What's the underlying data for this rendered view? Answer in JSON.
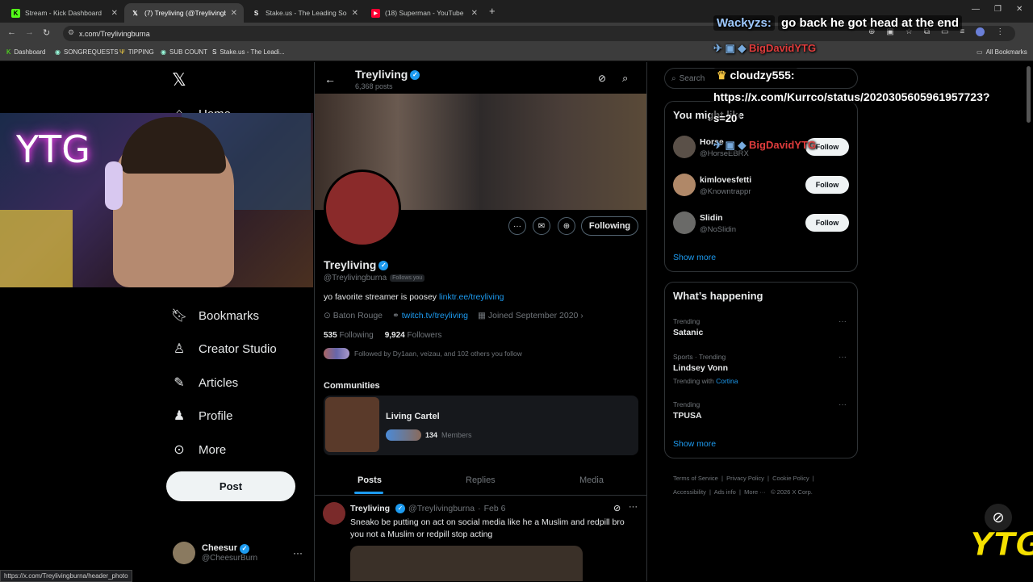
{
  "browser": {
    "tabs": [
      {
        "title": "Stream - Kick Dashboard",
        "favicon": "kick-icon"
      },
      {
        "title": "(7) Treyliving (@Treylivingburna) / X",
        "favicon": "x-icon"
      },
      {
        "title": "Stake.us - The Leading Social Casino",
        "favicon": "stake-icon"
      },
      {
        "title": "(18) Superman - YouTube",
        "favicon": "youtube-icon"
      }
    ],
    "url": "x.com/Treylivingburna",
    "bookmarks": [
      "Dashboard",
      "SONGREQUESTS",
      "TIPPING",
      "SUB COUNT",
      "Stake.us - The Leadi..."
    ],
    "all_bookmarks": "All Bookmarks",
    "status_url": "https://x.com/Treylivingburna/header_photo"
  },
  "sidebar": {
    "items": [
      {
        "label": "Home",
        "icon": "home-icon"
      },
      {
        "label": "Bookmarks",
        "icon": "bookmark-icon"
      },
      {
        "label": "Creator Studio",
        "icon": "creator-studio-icon"
      },
      {
        "label": "Articles",
        "icon": "articles-icon"
      },
      {
        "label": "Profile",
        "icon": "profile-icon"
      },
      {
        "label": "More",
        "icon": "more-circle-icon"
      }
    ],
    "post_label": "Post",
    "account": {
      "name": "Cheesur",
      "handle": "@CheesurBurn"
    }
  },
  "profile": {
    "header_name": "Treyliving",
    "post_count": "6,368 posts",
    "name": "Treyliving",
    "handle": "@Treylivingburna",
    "follows_you": "Follows you",
    "bio": "yo favorite streamer is poosey",
    "bio_link": "linktr.ee/treyliving",
    "location": "Baton Rouge",
    "website": "twitch.tv/treyliving",
    "joined": "Joined September 2020",
    "following_count": "535",
    "following_label": "Following",
    "followers_count": "9,924",
    "followers_label": "Followers",
    "followed_by": "Followed by Dy1aan, veizau, and 102 others you follow",
    "following_button": "Following"
  },
  "communities": {
    "heading": "Communities",
    "name": "Living Cartel",
    "members_count": "134",
    "members_label": "Members"
  },
  "tabs": [
    "Posts",
    "Replies",
    "Media"
  ],
  "post": {
    "name": "Treyliving",
    "handle": "@Treylivingburna",
    "date": "Feb 6",
    "line1": "Sneako be putting on act on social media like he a Muslim and redpill bro",
    "line2": "you not a Muslim or redpill stop acting"
  },
  "right": {
    "search_placeholder": "Search",
    "you_might_like": "You might like",
    "suggestions": [
      {
        "name": "Horse",
        "handle": "@HorseEBRX",
        "follow": "Follow"
      },
      {
        "name": "kimlovesfetti",
        "handle": "@Knowntrappr",
        "follow": "Follow"
      },
      {
        "name": "Slidin",
        "handle": "@NoSlidin",
        "follow": "Follow"
      }
    ],
    "show_more": "Show more",
    "whats_happening": "What’s happening",
    "trends": [
      {
        "context": "Trending",
        "title": "Satanic",
        "extra": ""
      },
      {
        "context": "Sports · Trending",
        "title": "Lindsey Vonn",
        "extra": "Trending with",
        "extra_link": "Cortina"
      },
      {
        "context": "Trending",
        "title": "TPUSA",
        "extra": ""
      }
    ],
    "show_more_2": "Show more",
    "footer": [
      "Terms of Service",
      "Privacy Policy",
      "Cookie Policy",
      "Accessibility",
      "Ads info",
      "More ···",
      "© 2026 X Corp."
    ]
  },
  "overlay": {
    "chat": [
      {
        "user": "Wackyzs:",
        "message": "go back he got head at the end"
      },
      {
        "user": "BigDavidYTG",
        "message": ""
      },
      {
        "user": "cloudzy555:",
        "message": "https://x.com/Kurrco/status/2020305605961957723?"
      },
      {
        "user": "BigDavidYTG",
        "message": ""
      }
    ],
    "chat_fragment": "s=20",
    "neon_text": "YTG",
    "logo_text": "YTG"
  }
}
